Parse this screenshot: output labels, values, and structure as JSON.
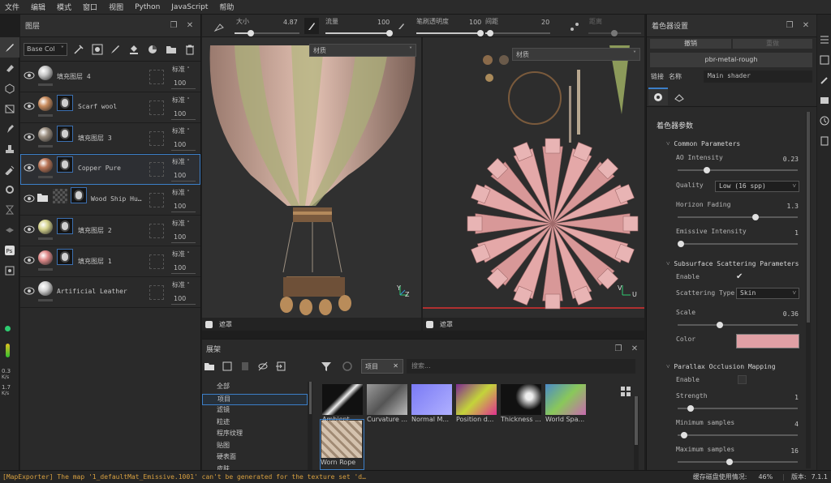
{
  "menu": [
    "文件",
    "编辑",
    "模式",
    "窗口",
    "视图",
    "Python",
    "JavaScript",
    "帮助"
  ],
  "layers_panel": {
    "title": "图层",
    "channel_select": "Base Col",
    "layers": [
      {
        "name": "填充图层 4",
        "blend": "标准",
        "opacity": "100",
        "color": "#c9c9c9",
        "mask": false,
        "folder": false
      },
      {
        "name": "Scarf wool",
        "blend": "标准",
        "opacity": "100",
        "color": "#c98c5e",
        "mask": true,
        "folder": false
      },
      {
        "name": "填充图层 3",
        "blend": "标准",
        "opacity": "100",
        "color": "#9a8e80",
        "mask": true,
        "folder": false
      },
      {
        "name": "Copper Pure",
        "blend": "标准",
        "opacity": "100",
        "color": "#b97456",
        "mask": true,
        "folder": false,
        "active": true
      },
      {
        "name": "Wood Ship Hu…",
        "blend": "标准",
        "opacity": "100",
        "color": "#777",
        "mask": true,
        "folder": true
      },
      {
        "name": "填充图层 2",
        "blend": "标准",
        "opacity": "100",
        "color": "#d6d48e",
        "mask": true,
        "folder": false
      },
      {
        "name": "填充图层 1",
        "blend": "标准",
        "opacity": "100",
        "color": "#e08a8a",
        "mask": true,
        "folder": false
      },
      {
        "name": "Artificial Leather",
        "blend": "标准",
        "opacity": "100",
        "color": "#d4d4d4",
        "mask": false,
        "folder": false
      }
    ]
  },
  "left_stats": {
    "v1": "0.3",
    "u1": "K/s",
    "v2": "1.7",
    "u2": "K/s"
  },
  "tool_settings": {
    "size_label": "大小",
    "size_value": "4.87",
    "flow_label": "流量",
    "flow_value": "100",
    "stroke_opacity_label": "笔刷透明度",
    "stroke_opacity_value": "100",
    "spacing_label": "间距",
    "spacing_value": "20",
    "distance_label": "距离"
  },
  "viewport3d": {
    "material_select": "材质",
    "footer": "遮罩"
  },
  "viewport2d": {
    "material_select": "材质",
    "footer": "遮罩"
  },
  "shelf": {
    "title": "展架",
    "filter_tag": "项目",
    "search_placeholder": "搜索...",
    "categories": [
      "全部",
      "项目",
      "滤镜",
      "粒迹",
      "程序纹理",
      "贴图",
      "硬表面",
      "皮肤"
    ],
    "selected_category": 1,
    "items": [
      {
        "label": "Ambient ...",
        "color": "#111"
      },
      {
        "label": "Curvature ...",
        "color": "#8a8a8a"
      },
      {
        "label": "Normal M...",
        "color": "#7a7af5"
      },
      {
        "label": "Position d...",
        "color": "#7f2a92"
      },
      {
        "label": "Thickness ...",
        "color": "#0c0c0c"
      },
      {
        "label": "World Spa...",
        "color": "#4a8ac8"
      },
      {
        "label": "Worn Rope",
        "color": "#c8b4a0"
      }
    ]
  },
  "shader_panel": {
    "title": "着色器设置",
    "undo": "撤销",
    "redo": "重做",
    "shader_name": "pbr-metal-rough",
    "link_label": "链接",
    "name_label": "名称",
    "name_value": "Main shader",
    "params_title": "着色器参数",
    "common": "Common Parameters",
    "ao_label": "AO Intensity",
    "ao_value": "0.23",
    "quality_label": "Quality",
    "quality_value": "Low (16 spp)",
    "horizon_label": "Horizon Fading",
    "horizon_value": "1.3",
    "emissive_label": "Emissive Intensity",
    "emissive_value": "1",
    "sss": "Subsurface Scattering Parameters",
    "enable_label": "Enable",
    "scatter_type_label": "Scattering Type",
    "scatter_type_value": "Skin",
    "scale_label": "Scale",
    "scale_value": "0.36",
    "color_label": "Color",
    "color_value": "#e0a0a5",
    "pom": "Parallax Occlusion Mapping",
    "enable2_label": "Enable",
    "strength_label": "Strength",
    "strength_value": "1",
    "min_label": "Minimum samples",
    "min_value": "4",
    "max_label": "Maximum samples",
    "max_value": "16"
  },
  "status": {
    "message": "[MapExporter] The map '1_defaultMat_Emissive.1001' can't be generated for the texture set 'd…",
    "cache": "缓存磁盘使用情况:",
    "cache_value": "46%",
    "version_label": "版本:",
    "version_value": "7.1.1"
  }
}
